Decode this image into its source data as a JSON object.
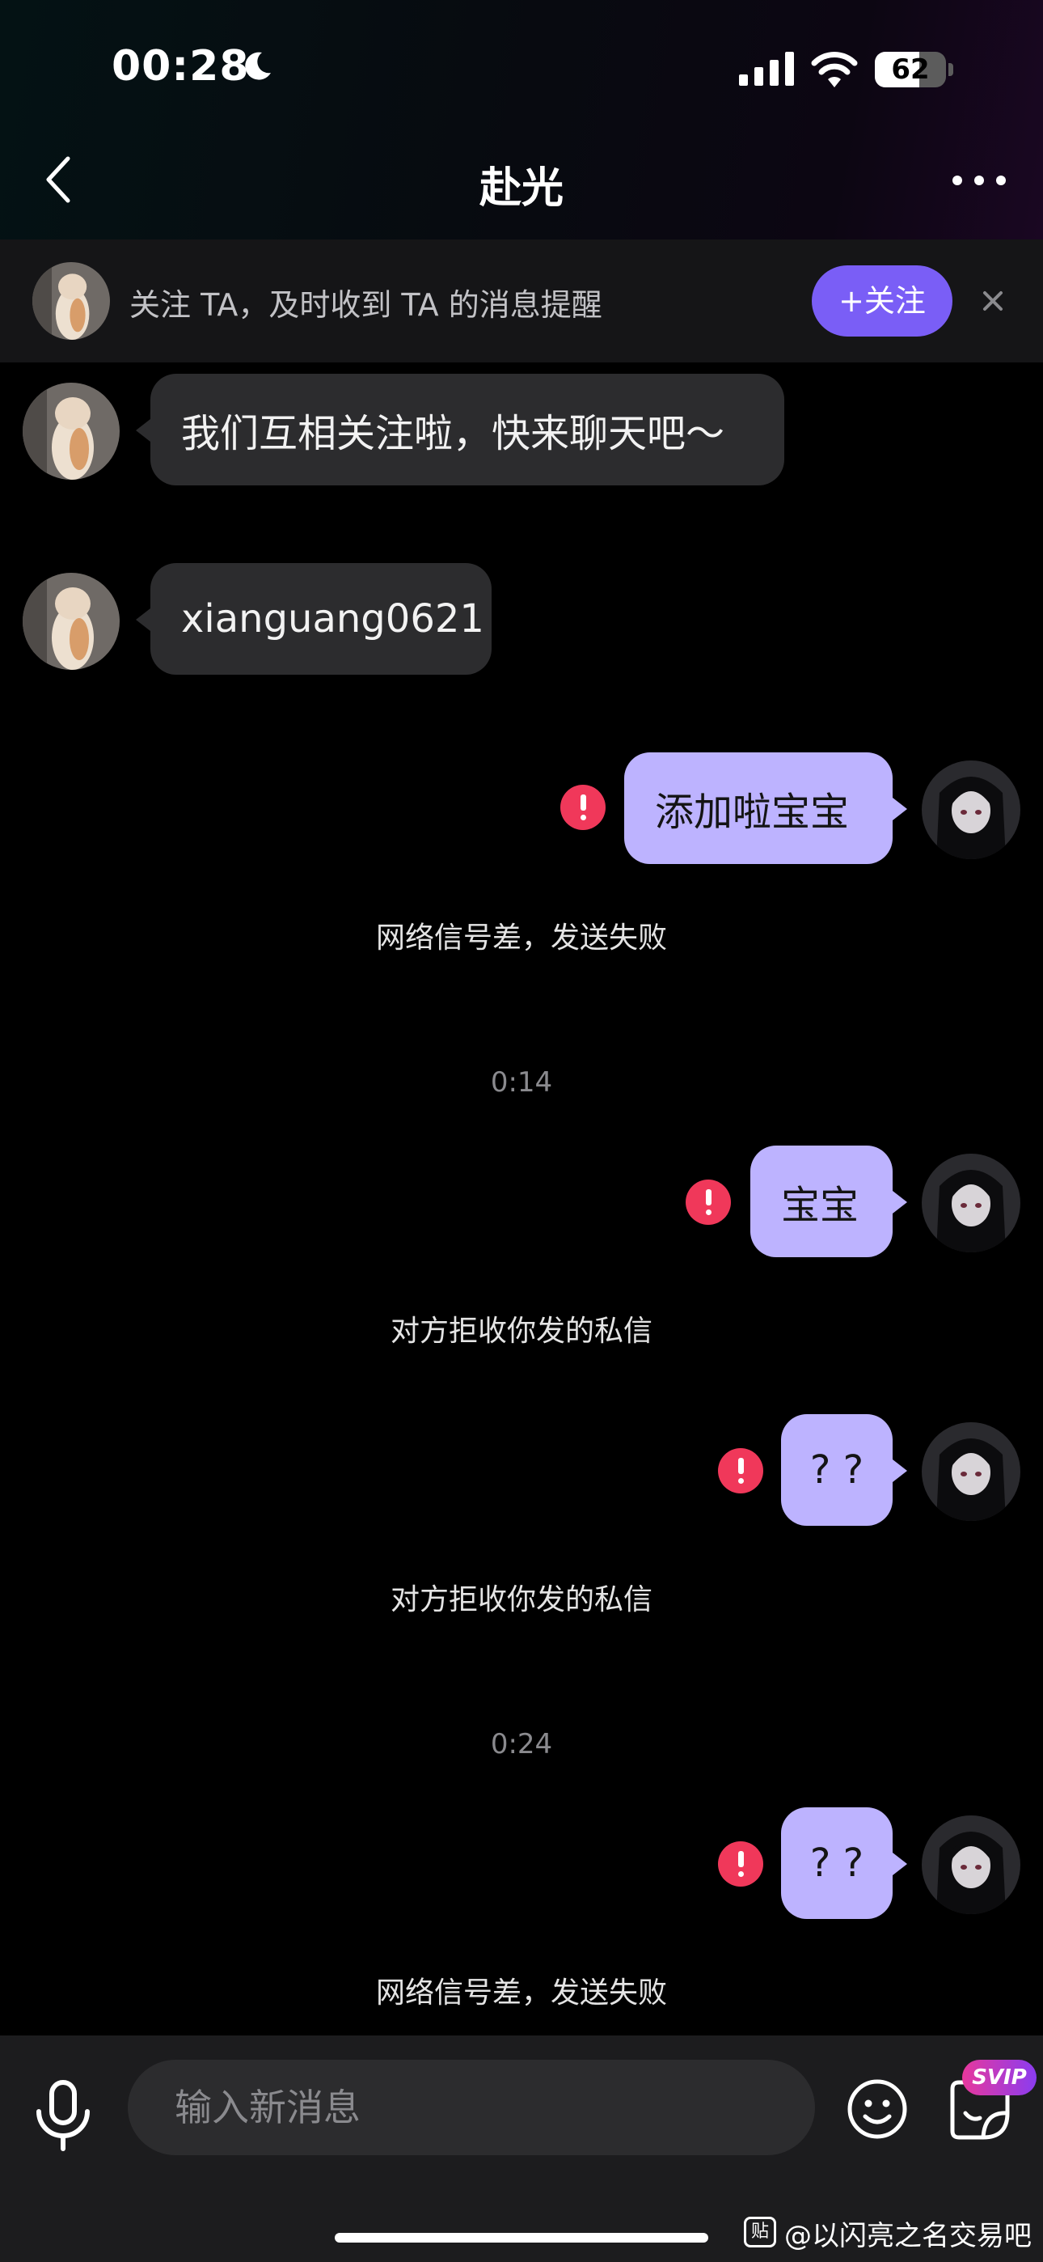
{
  "status_bar": {
    "time": "00:28",
    "battery": "62",
    "battery_level": 0.62
  },
  "nav": {
    "title": "赴光"
  },
  "banner": {
    "text": "关注 TA，及时收到 TA 的消息提醒",
    "follow_label": "+关注"
  },
  "messages": [
    {
      "from": "them",
      "text": "我们互相关注啦，快来聊天吧～"
    },
    {
      "from": "them",
      "text": "xianguang0621"
    },
    {
      "from": "me",
      "text": "添加啦宝宝",
      "failed": true,
      "notice": "网络信号差，发送失败"
    },
    {
      "timestamp": "0:14"
    },
    {
      "from": "me",
      "text": "宝宝",
      "failed": true,
      "notice": "对方拒收你发的私信"
    },
    {
      "from": "me",
      "text": "? ?",
      "failed": true,
      "notice": "对方拒收你发的私信"
    },
    {
      "timestamp": "0:24"
    },
    {
      "from": "me",
      "text": "? ?",
      "failed": true,
      "notice": "网络信号差，发送失败"
    }
  ],
  "input": {
    "placeholder": "输入新消息",
    "svip_badge": "SVIP"
  },
  "watermark": {
    "icon_text": "贴",
    "text": "@以闪亮之名交易吧"
  },
  "colors": {
    "accent": "#7a5ef6",
    "outgoing_bubble": "#bdb3ff",
    "incoming_bubble": "#2c2c2e",
    "error": "#f0385a"
  },
  "icons": [
    "moon-icon",
    "signal-icon",
    "wifi-icon",
    "battery-icon",
    "back-icon",
    "more-icon",
    "close-icon",
    "error-icon",
    "mic-icon",
    "emoji-icon",
    "sticker-icon"
  ]
}
